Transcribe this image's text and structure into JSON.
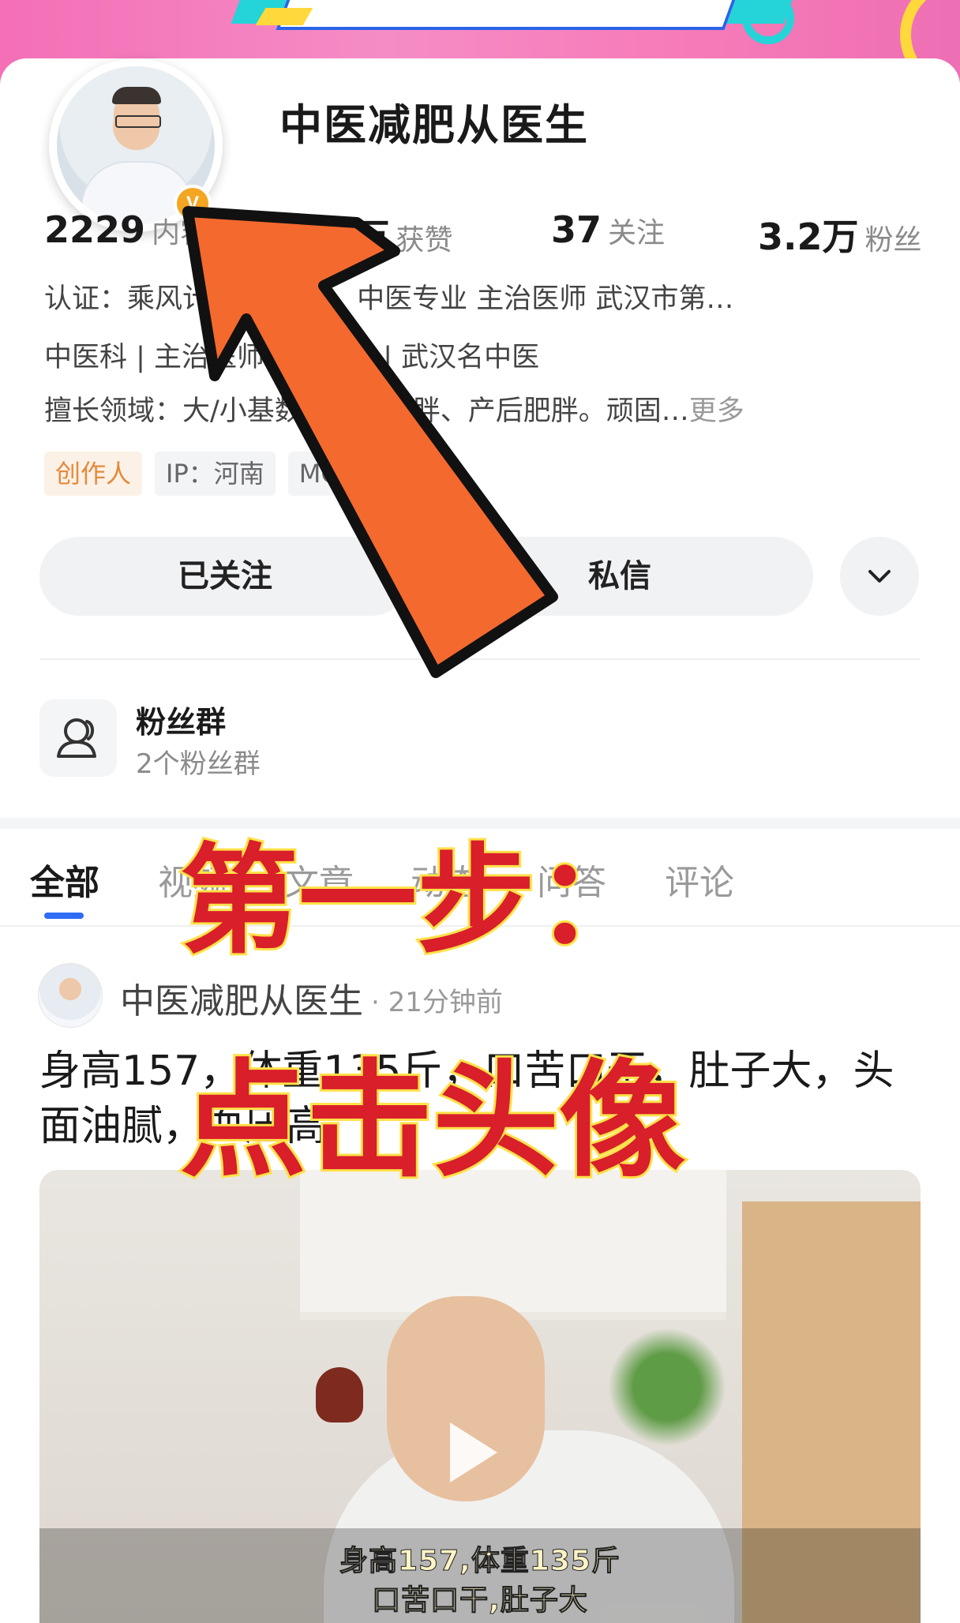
{
  "profile": {
    "name": "中医减肥从医生",
    "badge": "V",
    "stats": [
      {
        "num": "2229",
        "label": "内容"
      },
      {
        "num": "9.3万",
        "label": "获赞"
      },
      {
        "num": "37",
        "label": "关注"
      },
      {
        "num": "3.2万",
        "label": "粉丝"
      }
    ],
    "cert": "认证：乘风计划 从泽伟，中医专业 主治医师 武汉市第…",
    "title_line": "中医科 | 主治医师 | 三级甲 | 武汉名中医",
    "expertise": "擅长领域：大/小基数单纯性肥胖、产后肥胖。顽固…",
    "expertise_more": "更多",
    "tags": [
      "创作人",
      "IP：河南",
      "MCN"
    ],
    "follow_button": "已关注",
    "message_button": "私信"
  },
  "fan_group": {
    "title": "粉丝群",
    "subtitle": "2个粉丝群"
  },
  "tabs": [
    "全部",
    "视频",
    "文章",
    "动态",
    "问答",
    "评论"
  ],
  "post": {
    "author": "中医减肥从医生",
    "time": "· 21分钟前",
    "text": "身高157，体重135斤，口苦口干，肚子大，头面油腻，血压高",
    "video_caption_1": "身高157,体重135斤",
    "video_caption_2": "口苦口干,肚子大"
  },
  "overlay": {
    "step": "第一步：",
    "action": "点击头像"
  },
  "colors": {
    "accent_blue": "#2f6cf6",
    "arrow_orange": "#f4692e",
    "overlay_red": "#d81f2a",
    "overlay_outline": "#ffe14a",
    "creator_tag": "#e48a3c"
  }
}
